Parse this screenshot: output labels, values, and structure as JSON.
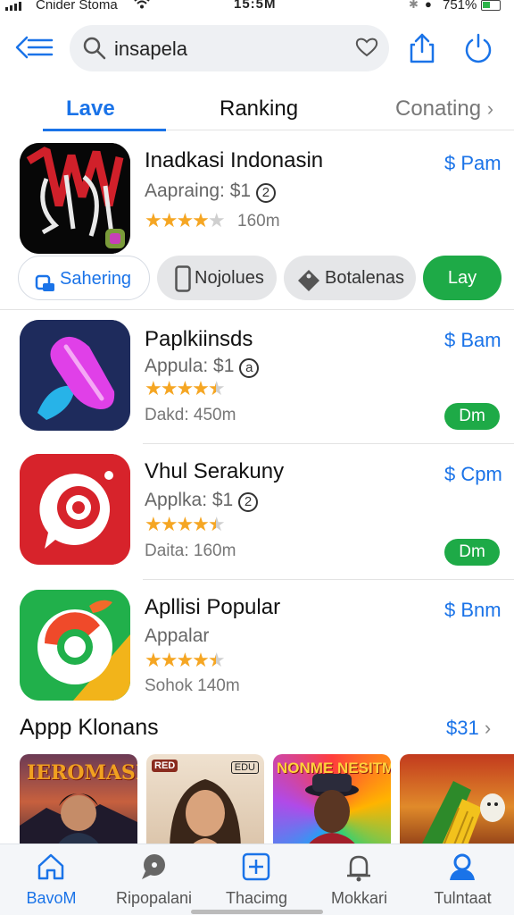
{
  "status_bar": {
    "carrier": "Cnider Stoma",
    "time": "15:5M",
    "battery": "751%"
  },
  "search": {
    "query": "insapela"
  },
  "tabs": [
    {
      "label": "Lave"
    },
    {
      "label": "Ranking"
    },
    {
      "label": "Conating"
    }
  ],
  "featured": {
    "name": "Inadkasi Indonasin",
    "subtitle": "Aapraing: $1",
    "badge": "2",
    "rating": 4,
    "downloads": "160m",
    "price": "$ Pam"
  },
  "chips": [
    {
      "label": "Sahering"
    },
    {
      "label": "Nojolues"
    },
    {
      "label": "Botalenas"
    },
    {
      "label": "Lay"
    }
  ],
  "apps": [
    {
      "name": "Paplkiinsds",
      "subtitle": "Appula: $1",
      "badge": "a",
      "rating": 4.5,
      "meta": "Dakd: 450m",
      "price": "$ Bam",
      "action": "Dm"
    },
    {
      "name": "Vhul Serakuny",
      "subtitle": "Applka: $1",
      "badge": "2",
      "rating": 4.5,
      "meta": "Daita: 160m",
      "price": "$ Cpm",
      "action": "Dm"
    },
    {
      "name": "Apllisi Popular",
      "subtitle": "Appalar",
      "rating": 4.5,
      "meta": "Sohok 140m",
      "price": "$ Bnm"
    }
  ],
  "section": {
    "title": "Appp Klonans",
    "more": "$31"
  },
  "banners": [
    {
      "title": "IEROMASK"
    },
    {
      "title": "RED",
      "tag": "EDU"
    },
    {
      "title": "NONME NESITM"
    },
    {
      "title": ""
    }
  ],
  "bottom_nav": [
    {
      "label": "BavoM"
    },
    {
      "label": "Ripopalani"
    },
    {
      "label": "Thacimg"
    },
    {
      "label": "Mokkari"
    },
    {
      "label": "Tulntaat"
    }
  ],
  "colors": {
    "accent": "#1a73e8",
    "green": "#1eaa47",
    "star": "#f5a623"
  }
}
